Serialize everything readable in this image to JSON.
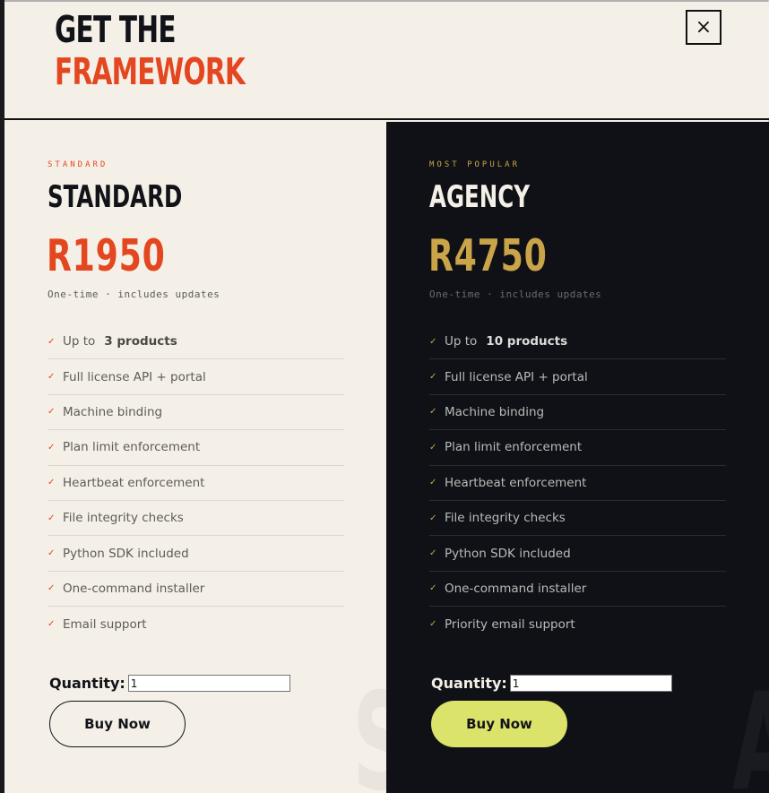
{
  "header": {
    "title_line1": "GET THE",
    "title_line2": "FRAMEWORK",
    "close_label": "×"
  },
  "plans": [
    {
      "eyebrow": "STANDARD",
      "name": "STANDARD",
      "price": "R1950",
      "note": "One-time · includes updates",
      "features": [
        {
          "label": "Up to",
          "value": "3 products"
        },
        {
          "label": "Full license API + portal"
        },
        {
          "label": "Machine binding"
        },
        {
          "label": "Plan limit enforcement"
        },
        {
          "label": "Heartbeat enforcement"
        },
        {
          "label": "File integrity checks"
        },
        {
          "label": "Python SDK included"
        },
        {
          "label": "One-command installer"
        },
        {
          "label": "Email support"
        }
      ],
      "quantity_label": "Quantity:",
      "quantity_value": "1",
      "buy_label": "Buy Now",
      "watermark": "S"
    },
    {
      "eyebrow": "MOST POPULAR",
      "name": "AGENCY",
      "price": "R4750",
      "note": "One-time · includes updates",
      "features": [
        {
          "label": "Up to",
          "value": "10 products"
        },
        {
          "label": "Full license API + portal"
        },
        {
          "label": "Machine binding"
        },
        {
          "label": "Plan limit enforcement"
        },
        {
          "label": "Heartbeat enforcement"
        },
        {
          "label": "File integrity checks"
        },
        {
          "label": "Python SDK included"
        },
        {
          "label": "One-command installer"
        },
        {
          "label": "Priority email support"
        }
      ],
      "quantity_label": "Quantity:",
      "quantity_value": "1",
      "buy_label": "Buy Now",
      "watermark": "A"
    }
  ],
  "check_icon": "✓",
  "colors": {
    "accent_orange": "#e4471f",
    "accent_gold": "#c9a449",
    "cream_background": "#f4f0e8",
    "dark_background": "#101116",
    "buy_highlight": "#dbe36b"
  }
}
